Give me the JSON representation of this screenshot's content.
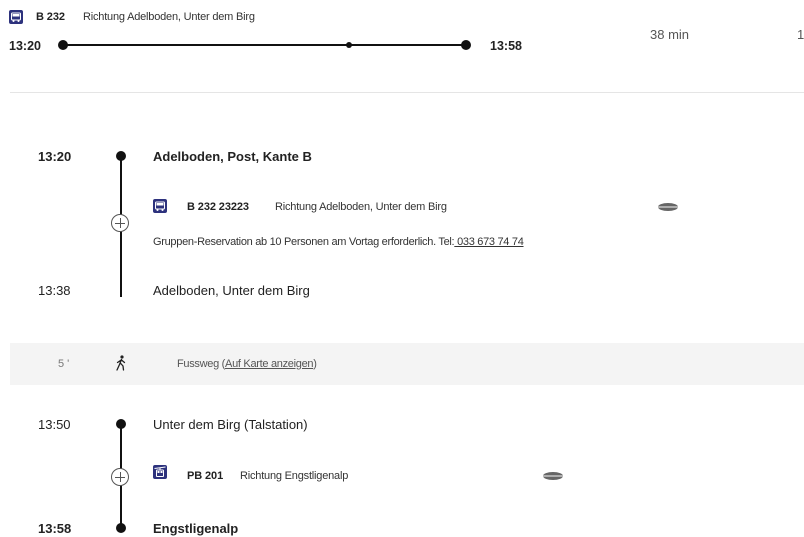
{
  "summary": {
    "service_icon": "bus-icon",
    "service_label": "B 232",
    "direction": "Richtung Adelboden, Unter dem Birg",
    "departure_time": "13:20",
    "arrival_time": "13:58",
    "duration": "38 min",
    "truncated_value": "1"
  },
  "legs": [
    {
      "departure_time": "13:20",
      "departure_stop": "Adelboden, Post, Kante B",
      "service_icon": "bus-icon",
      "service_label": "B 232 23223",
      "direction": "Richtung Adelboden, Unter dem Birg",
      "occupancy_icon": "occupancy-icon",
      "note_prefix": "Gruppen-Reservation ab 10 Personen am Vortag erforderlich. Tel:",
      "note_phone": " 033 673 74 74",
      "arrival_time": "13:38",
      "arrival_stop": "Adelboden, Unter dem Birg"
    },
    {
      "departure_time": "13:50",
      "departure_stop": "Unter dem Birg (Talstation)",
      "service_icon": "cable-car-icon",
      "service_label": "PB 201",
      "direction": "Richtung Engstligenalp",
      "occupancy_icon": "occupancy-icon",
      "arrival_time": "13:58",
      "arrival_stop": "Engstligenalp"
    }
  ],
  "walk": {
    "duration": "5 '",
    "icon": "walk-icon",
    "label_prefix": "Fussweg (",
    "map_link": "Auf Karte anzeigen",
    "label_suffix": ")"
  },
  "colors": {
    "service_icon_bg": "#2d327d",
    "line": "#111111",
    "walk_band": "#f4f4f4"
  }
}
